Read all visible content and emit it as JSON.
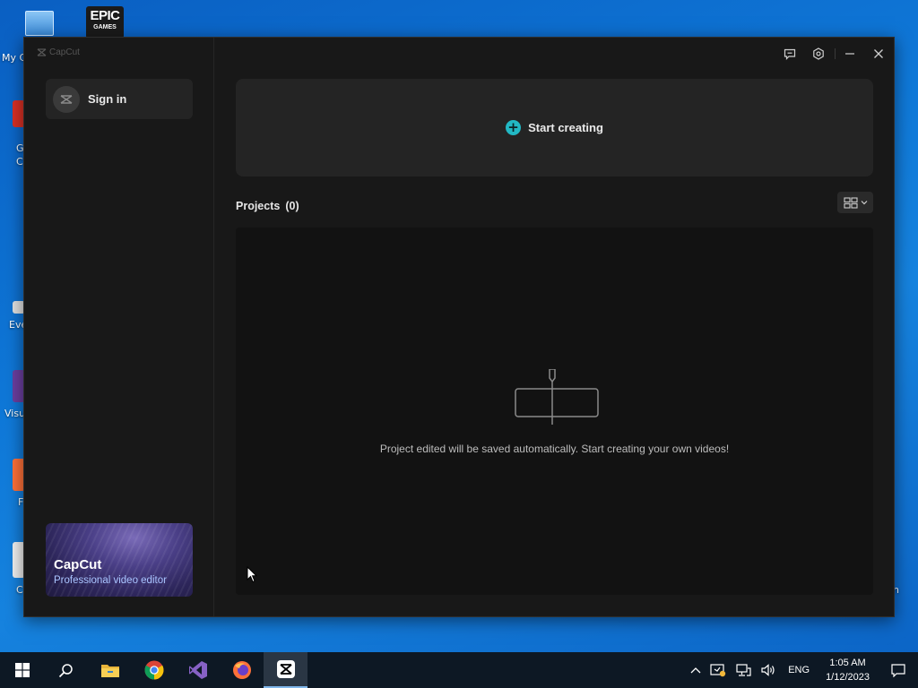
{
  "desktop": {
    "icons": [
      {
        "label": "My C",
        "icon": "computer-icon"
      },
      {
        "label": "G\nC",
        "icon": "chrome-shortcut-icon"
      },
      {
        "label": "Eve",
        "icon": "shortcut-icon"
      },
      {
        "label": "Visu",
        "icon": "visual-studio-shortcut-icon"
      },
      {
        "label": "F",
        "icon": "firefox-shortcut-icon"
      },
      {
        "label": "C",
        "icon": "shortcut-icon"
      }
    ],
    "epic": {
      "line1": "EPIC",
      "line2": "GAMES"
    },
    "right_edge_text": "n"
  },
  "app": {
    "name": "CapCut",
    "sidebar": {
      "sign_in_label": "Sign in",
      "promo_title": "CapCut",
      "promo_subtitle": "Professional video editor"
    },
    "titlebar": {
      "buttons": [
        "feedback-icon",
        "settings-icon",
        "minimize-icon",
        "close-icon"
      ]
    },
    "main": {
      "start_creating_label": "Start creating",
      "projects_label": "Projects",
      "projects_count": "(0)",
      "empty_message": "Project edited will be saved automatically. Start creating your own videos!"
    },
    "colors": {
      "accent": "#22b8c4",
      "background": "#181818",
      "panel": "#242424"
    }
  },
  "taskbar": {
    "items": [
      "start-icon",
      "search-icon",
      "file-explorer-icon",
      "chrome-icon",
      "visual-studio-icon",
      "firefox-icon",
      "capcut-icon"
    ],
    "active": "capcut-icon",
    "language": "ENG",
    "time": "1:05 AM",
    "date": "1/12/2023"
  }
}
